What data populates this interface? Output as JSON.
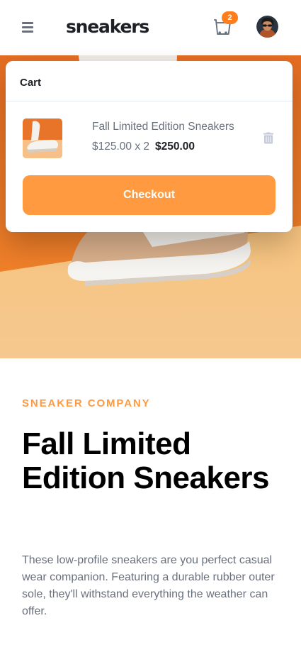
{
  "header": {
    "logo": "sneakers",
    "cart_count": "2",
    "menu_icon": "hamburger-icon",
    "cart_icon": "cart-icon",
    "avatar_icon": "user-avatar"
  },
  "cart": {
    "title": "Cart",
    "item": {
      "name": "Fall Limited Edition Sneakers",
      "unit_price_qty": "$125.00 x 2",
      "total": "$250.00"
    },
    "delete_icon": "trash-icon",
    "checkout_label": "Checkout"
  },
  "product": {
    "company": "SNEAKER COMPANY",
    "title": "Fall Limited Edition Sneakers",
    "description": "These low-profile sneakers are you perfect casual wear companion. Featuring a durable rubber outer sole, they'll withstand everything the weather can offer."
  },
  "colors": {
    "accent": "#ff7e1b",
    "accent_button": "#ff9a40",
    "text_dark": "#1d2025",
    "text_gray": "#69707d"
  }
}
